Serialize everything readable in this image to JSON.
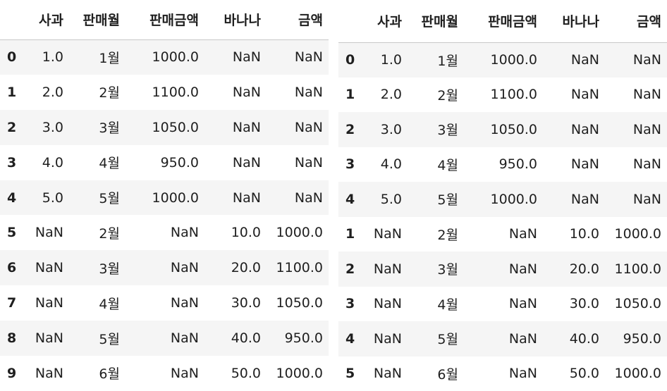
{
  "tables": [
    {
      "columns": [
        "사과",
        "판매월",
        "판매금액",
        "바나나",
        "금액"
      ],
      "rows": [
        {
          "index": "0",
          "cells": [
            "1.0",
            "1월",
            "1000.0",
            "NaN",
            "NaN"
          ]
        },
        {
          "index": "1",
          "cells": [
            "2.0",
            "2월",
            "1100.0",
            "NaN",
            "NaN"
          ]
        },
        {
          "index": "2",
          "cells": [
            "3.0",
            "3월",
            "1050.0",
            "NaN",
            "NaN"
          ]
        },
        {
          "index": "3",
          "cells": [
            "4.0",
            "4월",
            "950.0",
            "NaN",
            "NaN"
          ]
        },
        {
          "index": "4",
          "cells": [
            "5.0",
            "5월",
            "1000.0",
            "NaN",
            "NaN"
          ]
        },
        {
          "index": "5",
          "cells": [
            "NaN",
            "2월",
            "NaN",
            "10.0",
            "1000.0"
          ]
        },
        {
          "index": "6",
          "cells": [
            "NaN",
            "3월",
            "NaN",
            "20.0",
            "1100.0"
          ]
        },
        {
          "index": "7",
          "cells": [
            "NaN",
            "4월",
            "NaN",
            "30.0",
            "1050.0"
          ]
        },
        {
          "index": "8",
          "cells": [
            "NaN",
            "5월",
            "NaN",
            "40.0",
            "950.0"
          ]
        },
        {
          "index": "9",
          "cells": [
            "NaN",
            "6월",
            "NaN",
            "50.0",
            "1000.0"
          ]
        }
      ]
    },
    {
      "columns": [
        "사과",
        "판매월",
        "판매금액",
        "바나나",
        "금액"
      ],
      "rows": [
        {
          "index": "0",
          "cells": [
            "1.0",
            "1월",
            "1000.0",
            "NaN",
            "NaN"
          ]
        },
        {
          "index": "1",
          "cells": [
            "2.0",
            "2월",
            "1100.0",
            "NaN",
            "NaN"
          ]
        },
        {
          "index": "2",
          "cells": [
            "3.0",
            "3월",
            "1050.0",
            "NaN",
            "NaN"
          ]
        },
        {
          "index": "3",
          "cells": [
            "4.0",
            "4월",
            "950.0",
            "NaN",
            "NaN"
          ]
        },
        {
          "index": "4",
          "cells": [
            "5.0",
            "5월",
            "1000.0",
            "NaN",
            "NaN"
          ]
        },
        {
          "index": "1",
          "cells": [
            "NaN",
            "2월",
            "NaN",
            "10.0",
            "1000.0"
          ]
        },
        {
          "index": "2",
          "cells": [
            "NaN",
            "3월",
            "NaN",
            "20.0",
            "1100.0"
          ]
        },
        {
          "index": "3",
          "cells": [
            "NaN",
            "4월",
            "NaN",
            "30.0",
            "1050.0"
          ]
        },
        {
          "index": "4",
          "cells": [
            "NaN",
            "5월",
            "NaN",
            "40.0",
            "950.0"
          ]
        },
        {
          "index": "5",
          "cells": [
            "NaN",
            "6월",
            "NaN",
            "50.0",
            "1000.0"
          ]
        }
      ]
    }
  ]
}
